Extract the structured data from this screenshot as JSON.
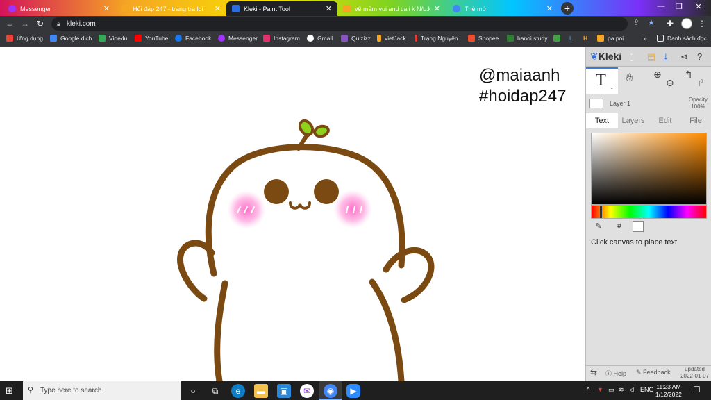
{
  "browser": {
    "tabs": [
      {
        "label": "Messenger",
        "color": "#a033ff"
      },
      {
        "label": "Hỏi đáp 247 - trang tra loi",
        "color": "#f5a623"
      },
      {
        "label": "Kleki - Paint Tool",
        "color": "#2d6cdf",
        "active": true
      },
      {
        "label": "vẽ mầm vui and cali k N/L:ko đẹp",
        "color": "#f5a623"
      },
      {
        "label": "Thẻ mới",
        "color": "#4285f4"
      }
    ],
    "new_tab": "+",
    "url": "kleki.com",
    "bookmarks": [
      {
        "label": "Ứng dụng",
        "color": "#ea4335"
      },
      {
        "label": "Google dịch",
        "color": "#4285f4"
      },
      {
        "label": "Vioedu",
        "color": "#34a853"
      },
      {
        "label": "YouTube",
        "color": "#ff0000"
      },
      {
        "label": "Facebook",
        "color": "#1877f2"
      },
      {
        "label": "Messenger",
        "color": "#a033ff"
      },
      {
        "label": "Instagram",
        "color": "#e1306c"
      },
      {
        "label": "Gmail",
        "color": "#ffffff"
      },
      {
        "label": "Quizizz",
        "color": "#8854c0"
      },
      {
        "label": "vietJack",
        "color": "#f5a623"
      },
      {
        "label": "Trạng Nguyên",
        "color": "#e53935"
      },
      {
        "label": "Shopee",
        "color": "#ee4d2d"
      },
      {
        "label": "hanoi study",
        "color": "#2e7d32"
      },
      {
        "label": "",
        "color": "#43a047"
      },
      {
        "label": "L",
        "color": "#1e88e5"
      },
      {
        "label": "H",
        "color": "#f5a623"
      },
      {
        "label": "pa poi",
        "color": "#f5a623"
      }
    ],
    "bookmarks_more": "»",
    "reading_list": "Danh sách đọc"
  },
  "canvas": {
    "watermark_line1": "@maiaanh",
    "watermark_line2": "#hoidap247"
  },
  "kleki": {
    "logo": "Kleki",
    "tool_glyph": "T",
    "layer_name": "Layer 1",
    "opacity_label": "Opacity",
    "opacity_value": "100%",
    "tabs": [
      "Text",
      "Layers",
      "Edit",
      "File"
    ],
    "hex_button": "#",
    "hint": "Click canvas to place text",
    "help": "Help",
    "feedback": "Feedback",
    "updated_label": "updated",
    "updated_date": "2022-01-07",
    "accent": "#ff8c00"
  },
  "taskbar": {
    "search_placeholder": "Type here to search",
    "lang": "ENG",
    "time": "11:23 AM",
    "date": "1/12/2022"
  }
}
